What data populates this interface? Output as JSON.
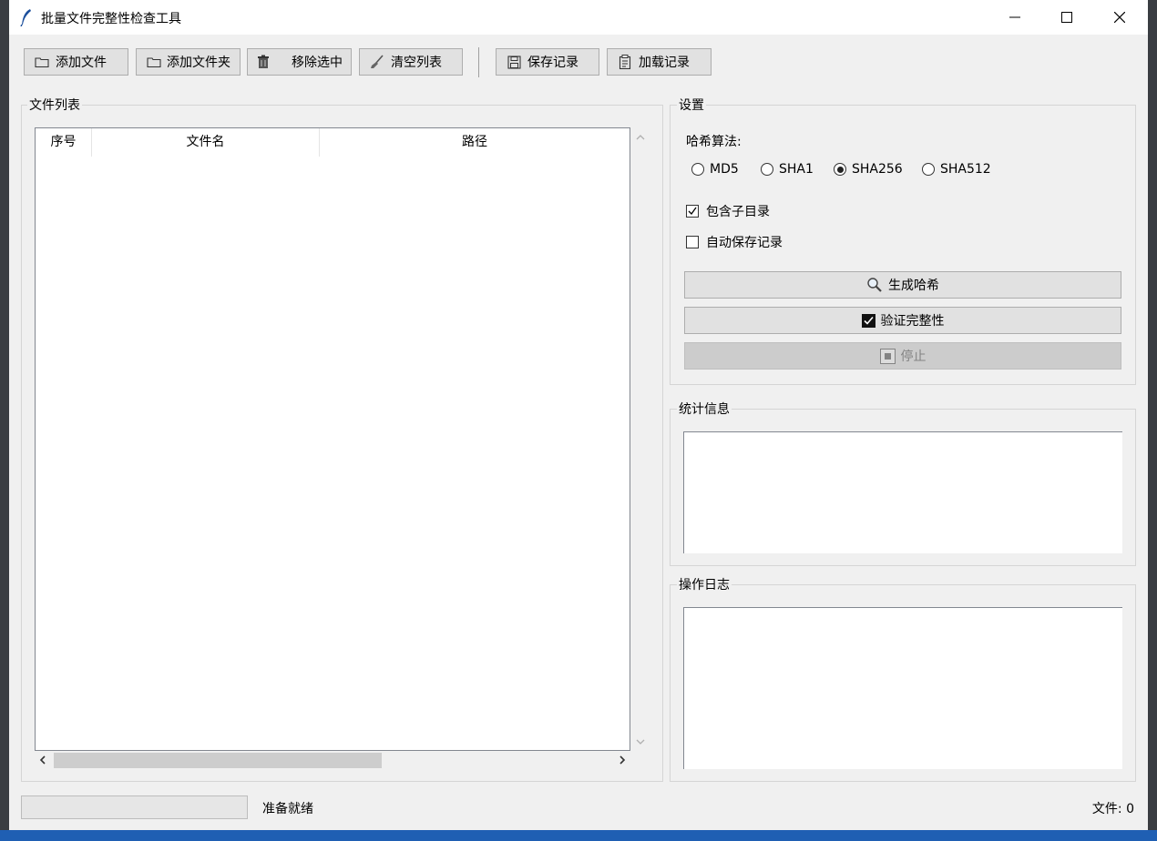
{
  "window": {
    "title": "批量文件完整性检查工具"
  },
  "toolbar": {
    "add_file": "添加文件",
    "add_folder": "添加文件夹",
    "remove_selected": "移除选中",
    "clear_list": "清空列表",
    "save_record": "保存记录",
    "load_record": "加载记录"
  },
  "file_list": {
    "group_title": "文件列表",
    "columns": [
      "序号",
      "文件名",
      "路径"
    ],
    "rows": []
  },
  "settings": {
    "group_title": "设置",
    "hash_label": "哈希算法:",
    "algorithms": [
      "MD5",
      "SHA1",
      "SHA256",
      "SHA512"
    ],
    "selected_algorithm": "SHA256",
    "include_subdirs_label": "包含子目录",
    "include_subdirs_checked": true,
    "auto_save_label": "自动保存记录",
    "auto_save_checked": false,
    "generate_hash": "生成哈希",
    "verify_integrity": "验证完整性",
    "stop": "停止"
  },
  "stats": {
    "group_title": "统计信息",
    "content": ""
  },
  "log": {
    "group_title": "操作日志",
    "content": ""
  },
  "status": {
    "text": "准备就绪",
    "file_count": "文件: 0"
  },
  "colors": {
    "window_bg": "#f0f0f0",
    "button_bg": "#e1e1e1",
    "button_border": "#adadad",
    "disabled_bg": "#cccccc",
    "taskbar": "#1f5fb3"
  }
}
